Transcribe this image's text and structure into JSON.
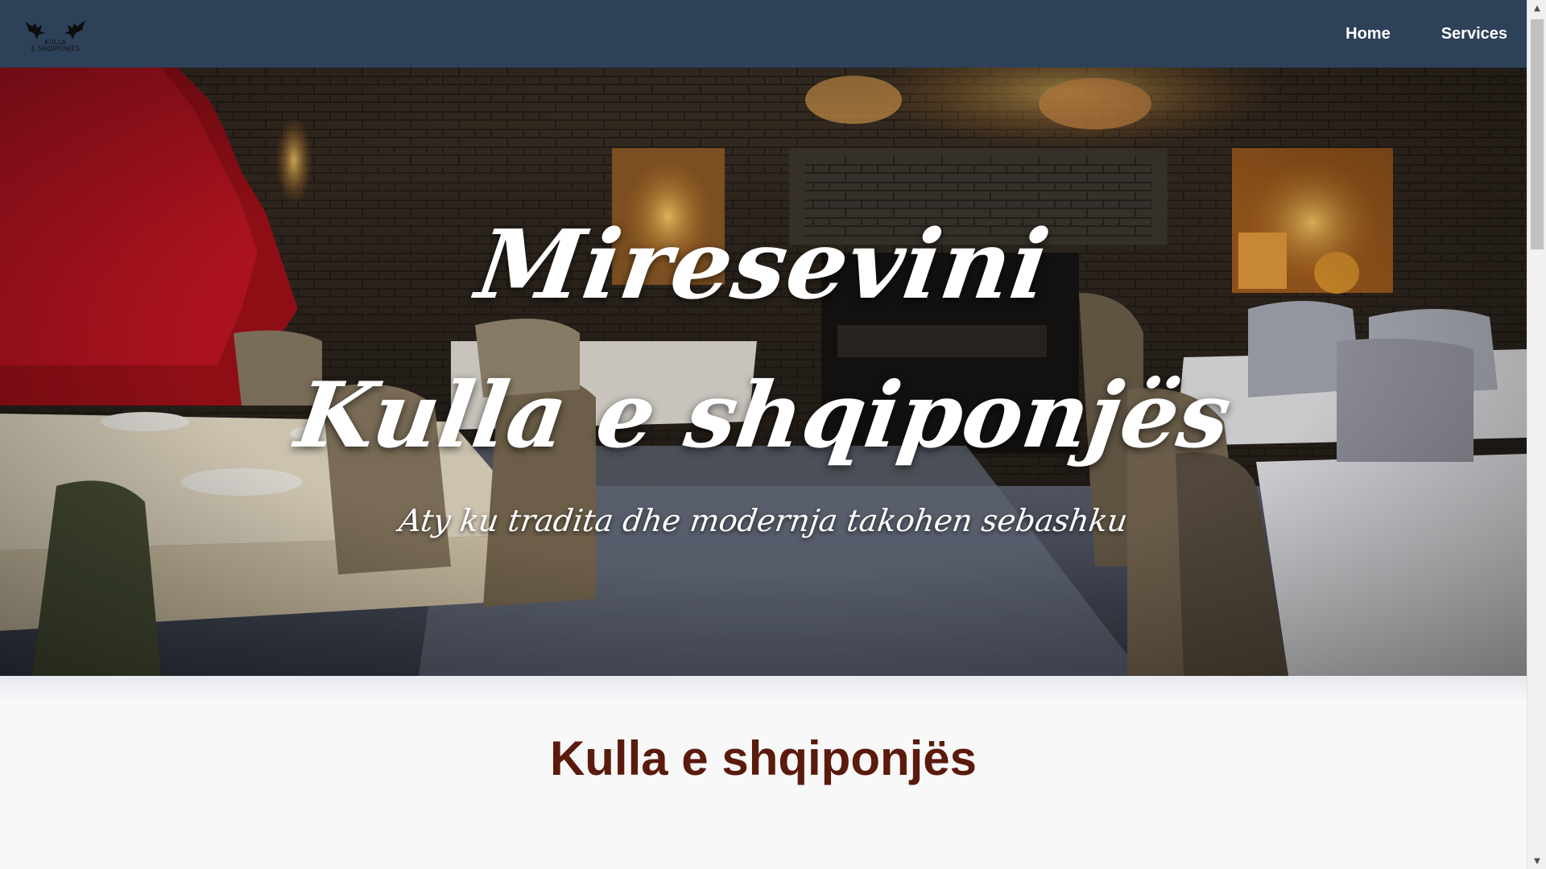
{
  "navbar": {
    "logo_text": "KULLA\nE SHQIPONJËS",
    "links": [
      {
        "label": "Home"
      },
      {
        "label": "Services"
      }
    ],
    "bg_color": "#2d4159"
  },
  "hero": {
    "welcome": "Miresevini",
    "name": "Kulla e shqiponjës",
    "tagline": "Aty ku tradita dhe modernja takohen sebashku"
  },
  "content": {
    "title": "Kulla e shqiponjës",
    "title_color": "#5a1a0c"
  },
  "icons": {
    "logo": "eagle-logo-icon",
    "scroll_up": "scroll-up-arrow-icon",
    "scroll_down": "scroll-down-arrow-icon"
  }
}
